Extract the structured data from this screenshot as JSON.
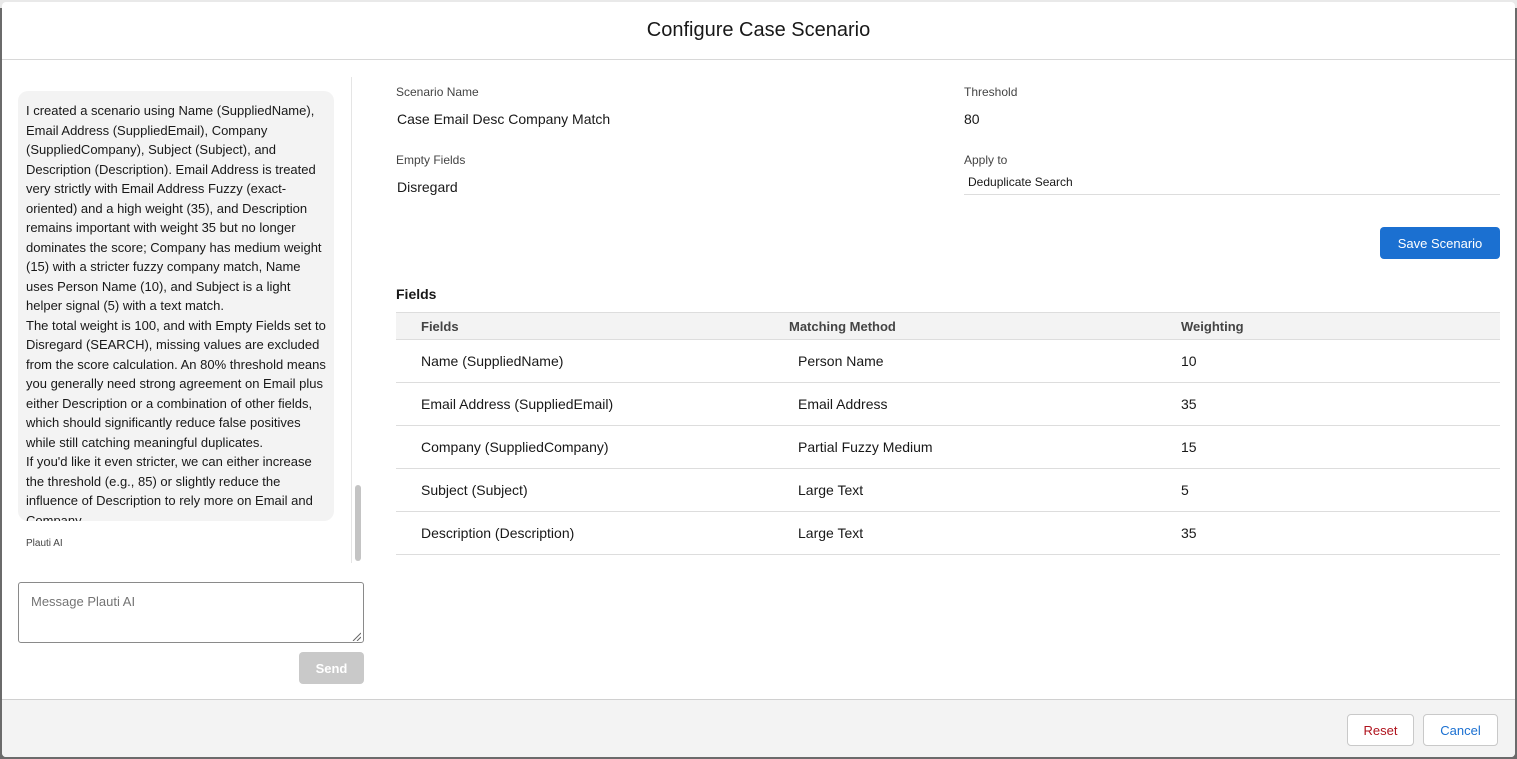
{
  "modal": {
    "title": "Configure Case Scenario"
  },
  "chat": {
    "message_paragraphs": [
      "I created a scenario using Name (SuppliedName), Email Address (SuppliedEmail), Company (SuppliedCompany), Subject (Subject), and Description (Description). Email Address is treated very strictly with Email Address Fuzzy (exact-oriented) and a high weight (35), and Description remains important with weight 35 but no longer dominates the score; Company has medium weight (15) with a stricter fuzzy company match, Name uses Person Name (10), and Subject is a light helper signal (5) with a text match.",
      "The total weight is 100, and with Empty Fields set to Disregard (SEARCH), missing values are excluded from the score calculation. An 80% threshold means you generally need strong agreement on Email plus either Description or a combination of other fields, which should significantly reduce false positives while still catching meaningful duplicates.",
      "If you'd like it even stricter, we can either increase the threshold (e.g., 85) or slightly reduce the influence of Description to rely more on Email and Company."
    ],
    "sender": "Plauti AI",
    "input_placeholder": "Message Plauti AI",
    "send_label": "Send"
  },
  "config": {
    "scenario_name_label": "Scenario Name",
    "scenario_name_value": "Case Email Desc Company Match",
    "threshold_label": "Threshold",
    "threshold_value": "80",
    "empty_fields_label": "Empty Fields",
    "empty_fields_value": "Disregard",
    "apply_to_label": "Apply to",
    "apply_to_value": "Deduplicate Search",
    "save_label": "Save Scenario",
    "fields_title": "Fields",
    "table": {
      "headers": [
        "Fields",
        "Matching Method",
        "Weighting"
      ],
      "rows": [
        [
          "Name (SuppliedName)",
          "Person Name",
          "10"
        ],
        [
          "Email Address (SuppliedEmail)",
          "Email Address",
          "35"
        ],
        [
          "Company (SuppliedCompany)",
          "Partial Fuzzy Medium",
          "15"
        ],
        [
          "Subject (Subject)",
          "Large Text",
          "5"
        ],
        [
          "Description (Description)",
          "Large Text",
          "35"
        ]
      ]
    }
  },
  "footer": {
    "reset_label": "Reset",
    "cancel_label": "Cancel"
  },
  "colors": {
    "brand_blue": "#1b70d1",
    "destructive_red": "#b0141e",
    "disabled_gray": "#c9c9c9"
  }
}
